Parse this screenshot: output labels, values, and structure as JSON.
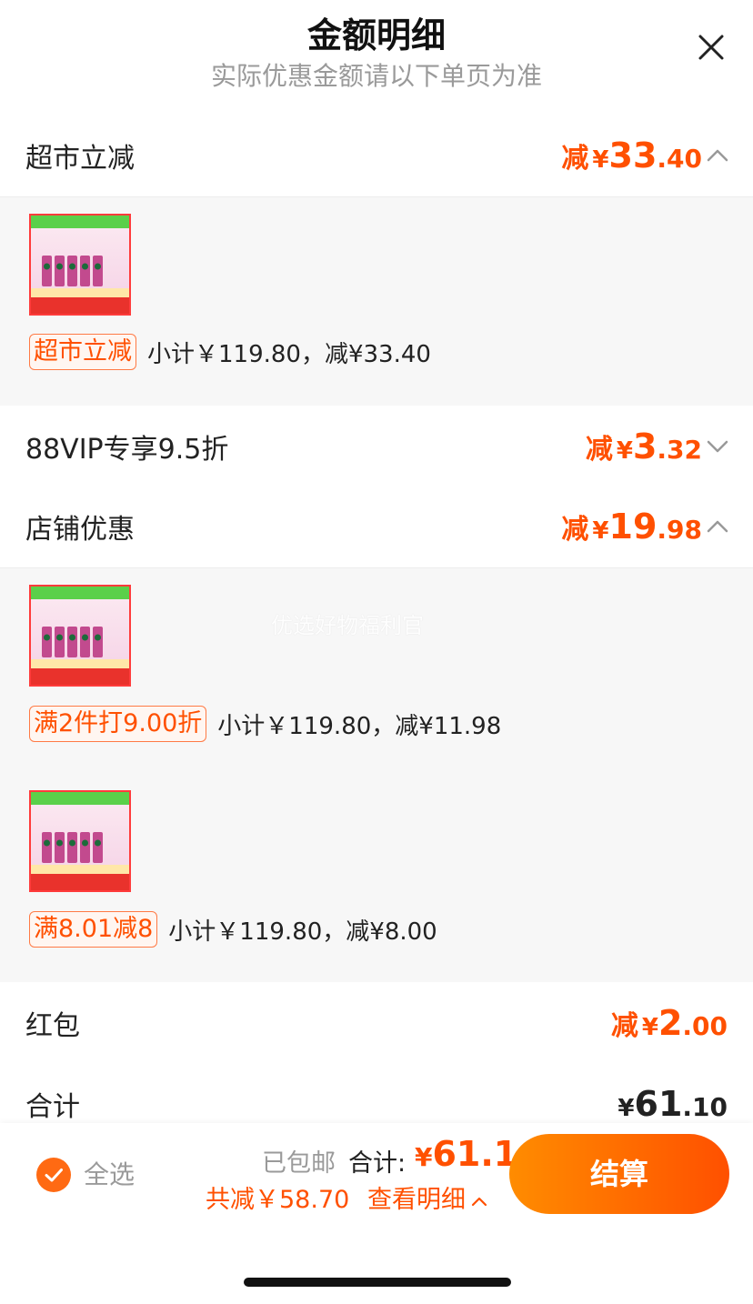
{
  "header": {
    "title": "金额明细",
    "subtitle": "实际优惠金额请以下单页为准"
  },
  "sections": {
    "supermarket": {
      "label": "超市立减",
      "prefix": "减",
      "yen": "¥",
      "int": "33",
      "dec": ".40",
      "expanded": true,
      "item": {
        "tag": "超市立减",
        "subtotal": "小计￥119.80，减¥33.40"
      }
    },
    "vip": {
      "label": "88VIP专享9.5折",
      "prefix": "减",
      "yen": "¥",
      "int": "3",
      "dec": ".32",
      "expanded": false
    },
    "store": {
      "label": "店铺优惠",
      "prefix": "减",
      "yen": "¥",
      "int": "19",
      "dec": ".98",
      "expanded": true,
      "items": [
        {
          "tag": "满2件打9.00折",
          "subtotal": "小计￥119.80，减¥11.98"
        },
        {
          "tag": "满8.01减8",
          "subtotal": "小计￥119.80，减¥8.00"
        }
      ]
    },
    "redpacket": {
      "label": "红包",
      "prefix": "减",
      "yen": "¥",
      "int": "2",
      "dec": ".00"
    },
    "total": {
      "label": "合计",
      "yen": "¥",
      "int": "61",
      "dec": ".10"
    }
  },
  "watermark": "优选好物福利官",
  "footer": {
    "select_all": "全选",
    "shipping": "已包邮",
    "total_label": "合计:",
    "total_yen": "¥",
    "total_value": "61.1",
    "saved": "共减￥58.70",
    "view_detail": "查看明细",
    "checkout": "结算"
  },
  "colors": {
    "accent": "#ff5000",
    "checkout_gradient_start": "#ff8c00",
    "detail_bg": "#f7f7f7"
  },
  "icons": {
    "close": "close-icon",
    "chevron_up": "chevron-up-icon",
    "chevron_down": "chevron-down-icon",
    "check": "check-icon"
  }
}
